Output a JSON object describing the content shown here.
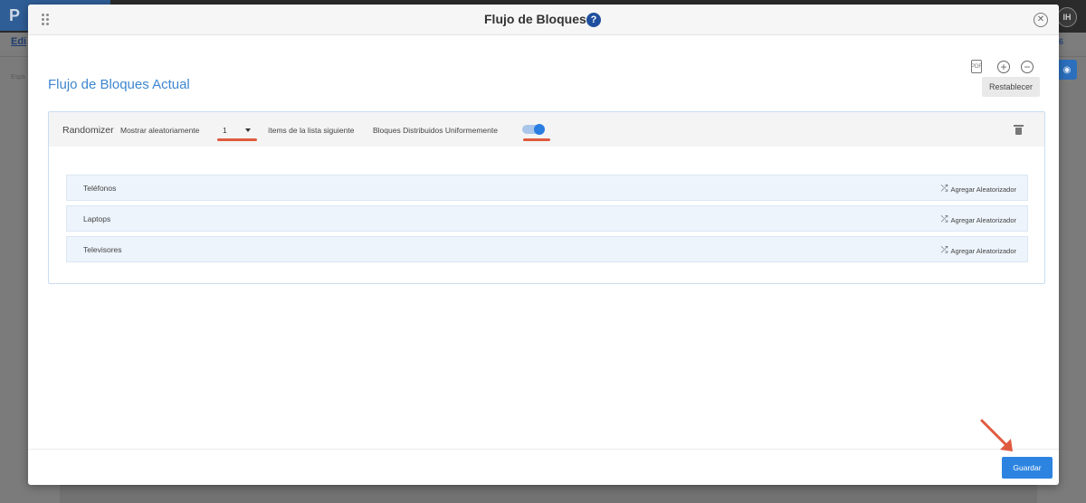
{
  "background": {
    "logo_letter": "P",
    "edit_label": "Edi",
    "counter_text": "6",
    "avatar_initials": "IH",
    "space_label": "Espa"
  },
  "modal": {
    "title": "Flujo de Bloques",
    "help_glyph": "?",
    "close_glyph": "✕",
    "section_title": "Flujo de Bloques Actual",
    "toolbar": {
      "pdf_glyph": "PDF",
      "zoom_in_glyph": "+",
      "zoom_out_glyph": "−",
      "reset_label": "Restablecer"
    },
    "randomizer": {
      "title": "Randomizer",
      "show_label": "Mostrar aleatoriamente",
      "selected_count": "1",
      "items_label": "ítems de la lista siguiente",
      "distributed_label": "Bloques Distribuidos Uniformemente",
      "distributed_on": true
    },
    "blocks": [
      {
        "label": "Teléfonos",
        "action": "Agregar Aleatorizador"
      },
      {
        "label": "Laptops",
        "action": "Agregar Aleatorizador"
      },
      {
        "label": "Televisores",
        "action": "Agregar Aleatorizador"
      }
    ],
    "save_label": "Guardar"
  },
  "colors": {
    "accent_blue": "#2d84e0",
    "title_blue": "#3d86cf",
    "annotation_red": "#e05a3f"
  }
}
